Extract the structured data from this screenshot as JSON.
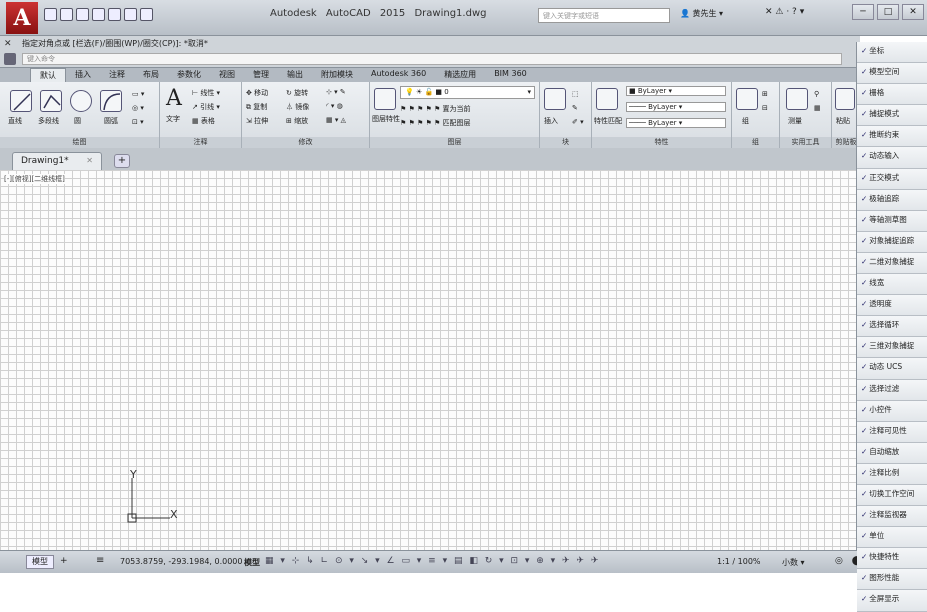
{
  "app": {
    "logo": "A",
    "title": "Autodesk AutoCAD 2015",
    "filename": "Drawing1.dwg",
    "search_placeholder": "键入关键字或短语",
    "user": "黄先生",
    "window_controls": [
      "─",
      "□",
      "✕"
    ]
  },
  "command": {
    "history": "指定对角点或 [栏选(F)/圈围(WP)/圈交(CP)]: *取消*",
    "input_placeholder": "键入命令"
  },
  "ribbon_tabs": [
    "默认",
    "插入",
    "注释",
    "布局",
    "参数化",
    "视图",
    "管理",
    "输出",
    "附加模块",
    "Autodesk 360",
    "精选应用",
    "BIM 360"
  ],
  "ribbon_active_tab": "默认",
  "panels": [
    {
      "name": "绘图",
      "tools": [
        "直线",
        "多段线",
        "圆",
        "圆弧"
      ]
    },
    {
      "name": "注释",
      "tools": [
        "文字",
        "线性",
        "引线",
        "表格"
      ]
    },
    {
      "name": "修改",
      "tools": [
        "移动",
        "旋转",
        "复制",
        "镜像",
        "拉伸",
        "缩放"
      ]
    },
    {
      "name": "图层",
      "tools": [
        "图层特性",
        "置为当前",
        "匹配图层"
      ]
    },
    {
      "name": "块",
      "tools": [
        "插入"
      ]
    },
    {
      "name": "特性",
      "tools": [
        "特性匹配",
        "ByLayer",
        "ByLayer",
        "ByLayer"
      ]
    },
    {
      "name": "组",
      "tools": [
        "组"
      ]
    },
    {
      "name": "实用工具",
      "tools": [
        "测量"
      ]
    },
    {
      "name": "剪贴板",
      "tools": [
        "粘贴"
      ]
    }
  ],
  "layer_current": "0",
  "doc_tab": "Drawing1*",
  "viewport_label": "[-][俯视][二维线框]",
  "ucs": {
    "x": "X",
    "y": "Y"
  },
  "statusbar": {
    "model_tab": "模型",
    "coords": "7053.8759, -293.1984, 0.0000",
    "model_label": "模型",
    "scale": "1:1 / 100%",
    "small_label": "小数"
  },
  "customize_items": [
    "坐标",
    "模型空间",
    "栅格",
    "捕捉模式",
    "推断约束",
    "动态输入",
    "正交模式",
    "极轴追踪",
    "等轴测草图",
    "对象捕捉追踪",
    "二维对象捕捉",
    "线宽",
    "透明度",
    "选择循环",
    "三维对象捕捉",
    "动态 UCS",
    "选择过滤",
    "小控件",
    "注释可见性",
    "自动缩放",
    "注释比例",
    "切换工作空间",
    "注释监视器",
    "单位",
    "快捷特性",
    "图形性能",
    "全屏显示"
  ]
}
